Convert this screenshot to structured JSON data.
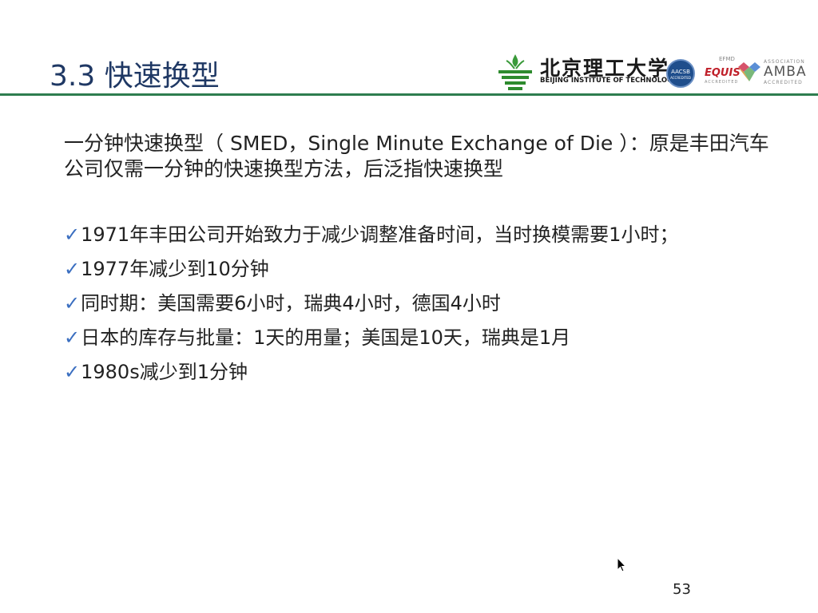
{
  "slide": {
    "title": "3.3  快速换型",
    "intro": "一分钟快速换型（ SMED，Single Minute Exchange of Die ）：原是丰田汽车公司仅需一分钟的快速换型方法，后泛指快速换型",
    "bullets": [
      "1971年丰田公司开始致力于减少调整准备时间，当时换模需要1小时；",
      "1977年减少到10分钟",
      "同时期：美国需要6小时，瑞典4小时，德国4小时",
      "日本的库存与批量：1天的用量；美国是10天，瑞典是1月",
      "1980s减少到1分钟"
    ],
    "page_number": "53"
  },
  "logos": {
    "bit_cn": "北京理工大学",
    "bit_en": "BEIJING INSTITUTE OF TECHNOLOGY",
    "aacsb_name": "AACSB",
    "aacsb_sub": "ACCREDITED",
    "equis_top": "EFMD",
    "equis": "EQUIS",
    "equis_sub": "ACCREDITED",
    "amba_top": "ASSOCIATION",
    "amba": "AMBA",
    "amba_sub": "ACCREDITED"
  },
  "colors": {
    "title": "#1f3864",
    "rule": "#2e7d4f",
    "check": "#3a6ec0",
    "text": "#222222"
  },
  "icons": {
    "bullet": "check-icon",
    "pointer": "mouse-cursor-icon"
  }
}
